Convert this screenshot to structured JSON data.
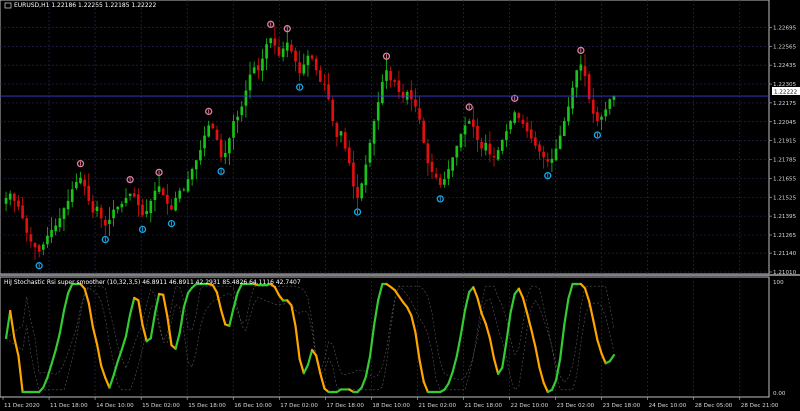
{
  "main": {
    "title": "EURUSD,H1  1.22186 1.22255 1.22185 1.22222",
    "price_labels": [
      "1.22695",
      "1.22565",
      "1.22435",
      "1.22305",
      "1.22175",
      "1.22045",
      "1.21915",
      "1.21785",
      "1.21655",
      "1.21525",
      "1.21395",
      "1.21265",
      "1.21140",
      "1.21010"
    ],
    "current_price": "1.22222",
    "colors": {
      "bull": "#18c418",
      "bear": "#e01010",
      "arrow_up": "#1aa6e6",
      "arrow_dn": "#e080a0",
      "grid": "#2b2b6b",
      "current_line": "#3a3ad6"
    }
  },
  "indicator": {
    "title": "HiJ Stochastic Rsi super smoother (10,32,3,5) 46.8911 46.8911 42.2931 85.4826 64.1116 42.7407",
    "level_top": "100",
    "level_bottom": "0.00",
    "colors": {
      "up": "#33cc33",
      "down": "#ffa500",
      "bands": "#5a5a5a"
    }
  },
  "time_axis": [
    "11 Dec 2020",
    "11 Dec 18:00",
    "14 Dec 10:00",
    "15 Dec 02:00",
    "15 Dec 18:00",
    "16 Dec 10:00",
    "17 Dec 02:00",
    "17 Dec 18:00",
    "18 Dec 10:00",
    "21 Dec 02:00",
    "21 Dec 18:00",
    "22 Dec 10:00",
    "23 Dec 02:00",
    "23 Dec 18:00",
    "24 Dec 10:00",
    "28 Dec 05:00",
    "28 Dec 21:00"
  ],
  "chart_data": {
    "type": "candlestick",
    "symbol": "EURUSD",
    "timeframe": "H1",
    "ylim": [
      1.2101,
      1.2276
    ],
    "closes": [
      1.2152,
      1.2155,
      1.215,
      1.2146,
      1.2138,
      1.2128,
      1.2122,
      1.2118,
      1.2115,
      1.212,
      1.2126,
      1.213,
      1.2133,
      1.2138,
      1.2145,
      1.215,
      1.2158,
      1.2163,
      1.2166,
      1.216,
      1.215,
      1.2142,
      1.2146,
      1.2138,
      1.2133,
      1.2137,
      1.2144,
      1.2146,
      1.2148,
      1.2152,
      1.2155,
      1.2153,
      1.2147,
      1.214,
      1.2143,
      1.215,
      1.2157,
      1.216,
      1.2154,
      1.2148,
      1.2144,
      1.2152,
      1.2157,
      1.2158,
      1.2165,
      1.2172,
      1.2178,
      1.2185,
      1.2195,
      1.2202,
      1.22,
      1.2192,
      1.218,
      1.2183,
      1.2193,
      1.2205,
      1.2208,
      1.2215,
      1.2226,
      1.2237,
      1.2242,
      1.224,
      1.2248,
      1.2258,
      1.2262,
      1.2257,
      1.225,
      1.2255,
      1.2259,
      1.2253,
      1.2246,
      1.2238,
      1.2244,
      1.225,
      1.2248,
      1.224,
      1.2232,
      1.223,
      1.222,
      1.2205,
      1.2194,
      1.2198,
      1.2186,
      1.2176,
      1.216,
      1.2152,
      1.2162,
      1.2175,
      1.219,
      1.2205,
      1.2218,
      1.2232,
      1.224,
      1.2233,
      1.2232,
      1.2225,
      1.2221,
      1.2225,
      1.222,
      1.2215,
      1.2206,
      1.219,
      1.2176,
      1.217,
      1.2166,
      1.2161,
      1.2165,
      1.2172,
      1.218,
      1.2188,
      1.2196,
      1.2202,
      1.2205,
      1.2201,
      1.2192,
      1.2186,
      1.219,
      1.2182,
      1.218,
      1.2185,
      1.2192,
      1.2198,
      1.2205,
      1.2211,
      1.2207,
      1.2203,
      1.2198,
      1.2193,
      1.2188,
      1.2184,
      1.218,
      1.2177,
      1.2179,
      1.2186,
      1.2195,
      1.2205,
      1.2215,
      1.2228,
      1.224,
      1.2244,
      1.2236,
      1.222,
      1.221,
      1.2205,
      1.2208,
      1.2213,
      1.222,
      1.2222
    ]
  }
}
